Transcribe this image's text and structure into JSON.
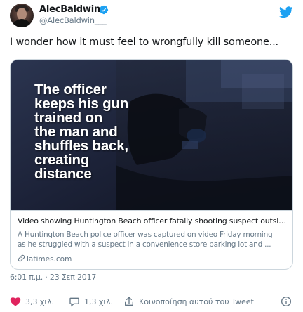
{
  "header": {
    "display_name": "AlecBaldwin",
    "handle": "@AlecBaldwin___"
  },
  "tweet": {
    "text": "I wonder how it must feel to wrongfully kill someone..."
  },
  "card": {
    "overlay_lines": [
      "The officer",
      "keeps his gun",
      "trained on",
      "the man and",
      "shuffles back,",
      "creating",
      "distance"
    ],
    "title": "Video showing Huntington Beach officer fatally shooting suspect outsid...",
    "description_lines": [
      "A Huntington Beach police officer was captured on video Friday morning",
      "as he struggled with a suspect in a convenience store parking lot and ..."
    ],
    "link": "latimes.com"
  },
  "timestamp": "6:01 π.μ. · 23 Σεπ 2017",
  "actions": {
    "likes": "3,3 χιλ.",
    "replies": "1,3 χιλ.",
    "share_label": "Κοινοποίηση αυτού του Tweet"
  },
  "icons": {
    "verified": "verified-badge-icon",
    "brand": "twitter-bird-icon",
    "like": "heart-icon",
    "reply": "speech-bubble-icon",
    "share": "share-icon",
    "info": "info-icon",
    "link": "link-icon"
  },
  "colors": {
    "twitter_blue": "#1da1f2",
    "secondary_text": "#657786",
    "like_red": "#e0245e"
  }
}
